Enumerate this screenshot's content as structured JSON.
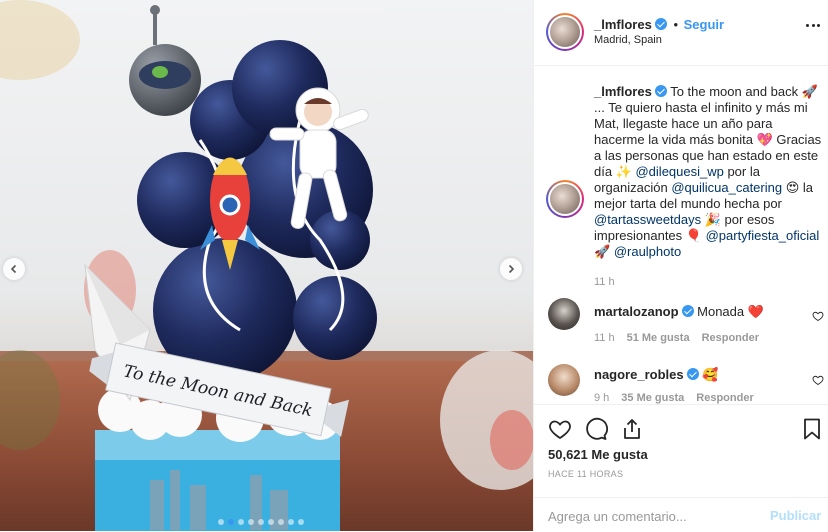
{
  "header": {
    "username": "_lmflores",
    "separator": "•",
    "follow_label": "Seguir",
    "location": "Madrid, Spain"
  },
  "caption": {
    "username": "_lmflores",
    "text_1": "To the moon and back 🚀 ... Te quiero hasta el infinito y más mi Mat, llegaste hace un año para hacerme la vida más bonita 💖 Gracias a las personas que han estado en este día ✨ ",
    "mention_1": "@dilequesi_wp",
    "text_2": " por la organización ",
    "mention_2": "@quilicua_catering",
    "text_3": " 😍 la mejor tarta del mundo hecha por ",
    "mention_3": "@tartassweetdays",
    "text_4": " 🎉 por esos impresionantes 🎈 ",
    "mention_4": "@partyfiesta_oficial",
    "text_5": " 🚀 ",
    "mention_5": "@raulphoto",
    "time": "11 h"
  },
  "comments": [
    {
      "username": "martalozanop",
      "text": "Monada ❤️",
      "time": "11 h",
      "likes": "51 Me gusta",
      "reply_label": "Responder"
    },
    {
      "username": "nagore_robles",
      "text": "🥰",
      "time": "9 h",
      "likes": "35 Me gusta",
      "reply_label": "Responder"
    }
  ],
  "actions": {
    "likes_count": "50,621 Me gusta",
    "time_ago": "HACE 11 HORAS"
  },
  "add_comment": {
    "placeholder": "Agrega un comentario...",
    "publish_label": "Publicar"
  },
  "media": {
    "carousel_total": 9,
    "carousel_active": 2,
    "banner_text": "To the Moon and Back"
  },
  "colors": {
    "accent": "#3897f0",
    "mention": "#003569",
    "muted": "#999999",
    "publish_disabled": "#b2dffc",
    "heart_red": "#ed4956"
  }
}
